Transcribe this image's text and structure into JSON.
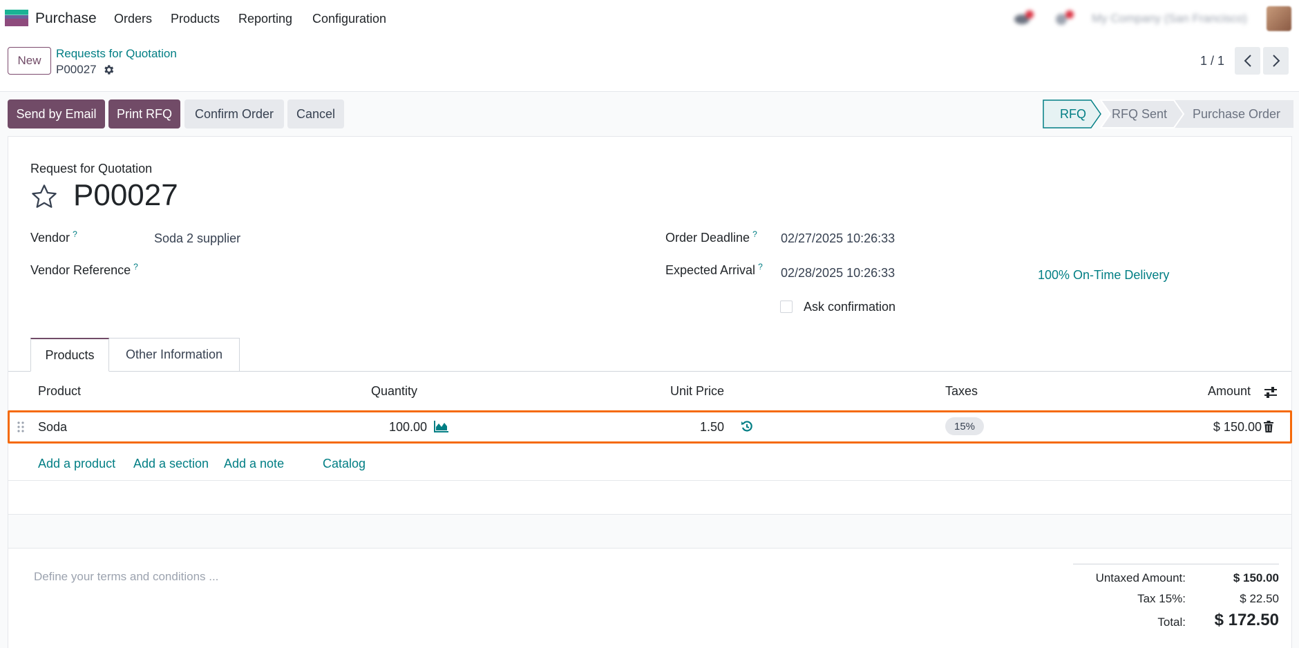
{
  "navbar": {
    "app_name": "Purchase",
    "menus": [
      "Orders",
      "Products",
      "Reporting",
      "Configuration"
    ],
    "company": "My Company (San Francisco)"
  },
  "control_panel": {
    "new_label": "New",
    "breadcrumb": "Requests for Quotation",
    "record_name": "P00027",
    "pager": "1 / 1"
  },
  "actions": {
    "send_email": "Send by Email",
    "print_rfq": "Print RFQ",
    "confirm": "Confirm Order",
    "cancel": "Cancel"
  },
  "stages": [
    "RFQ",
    "RFQ Sent",
    "Purchase Order"
  ],
  "form": {
    "doc_type": "Request for Quotation",
    "doc_name": "P00027",
    "vendor_label": "Vendor",
    "vendor_value": "Soda 2 supplier",
    "vendor_ref_label": "Vendor Reference",
    "order_deadline_label": "Order Deadline",
    "order_deadline_value": "02/27/2025 10:26:33",
    "expected_arrival_label": "Expected Arrival",
    "expected_arrival_value": "02/28/2025 10:26:33",
    "on_time": "100% On-Time Delivery",
    "ask_confirmation": "Ask confirmation",
    "help_mark": "?"
  },
  "tabs": [
    "Products",
    "Other Information"
  ],
  "table": {
    "headers": {
      "product": "Product",
      "quantity": "Quantity",
      "unit_price": "Unit Price",
      "taxes": "Taxes",
      "amount": "Amount"
    },
    "rows": [
      {
        "product": "Soda",
        "quantity": "100.00",
        "unit_price": "1.50",
        "taxes": "15%",
        "amount": "$ 150.00"
      }
    ],
    "add_links": [
      "Add a product",
      "Add a section",
      "Add a note",
      "Catalog"
    ]
  },
  "terms_placeholder": "Define your terms and conditions ...",
  "totals": {
    "untaxed_label": "Untaxed Amount:",
    "untaxed_value": "$ 150.00",
    "tax_label": "Tax 15%:",
    "tax_value": "$ 22.50",
    "total_label": "Total:",
    "total_value": "$ 172.50"
  },
  "colors": {
    "brand": "#714b67",
    "link": "#017e84",
    "highlight": "#f56a0a"
  }
}
